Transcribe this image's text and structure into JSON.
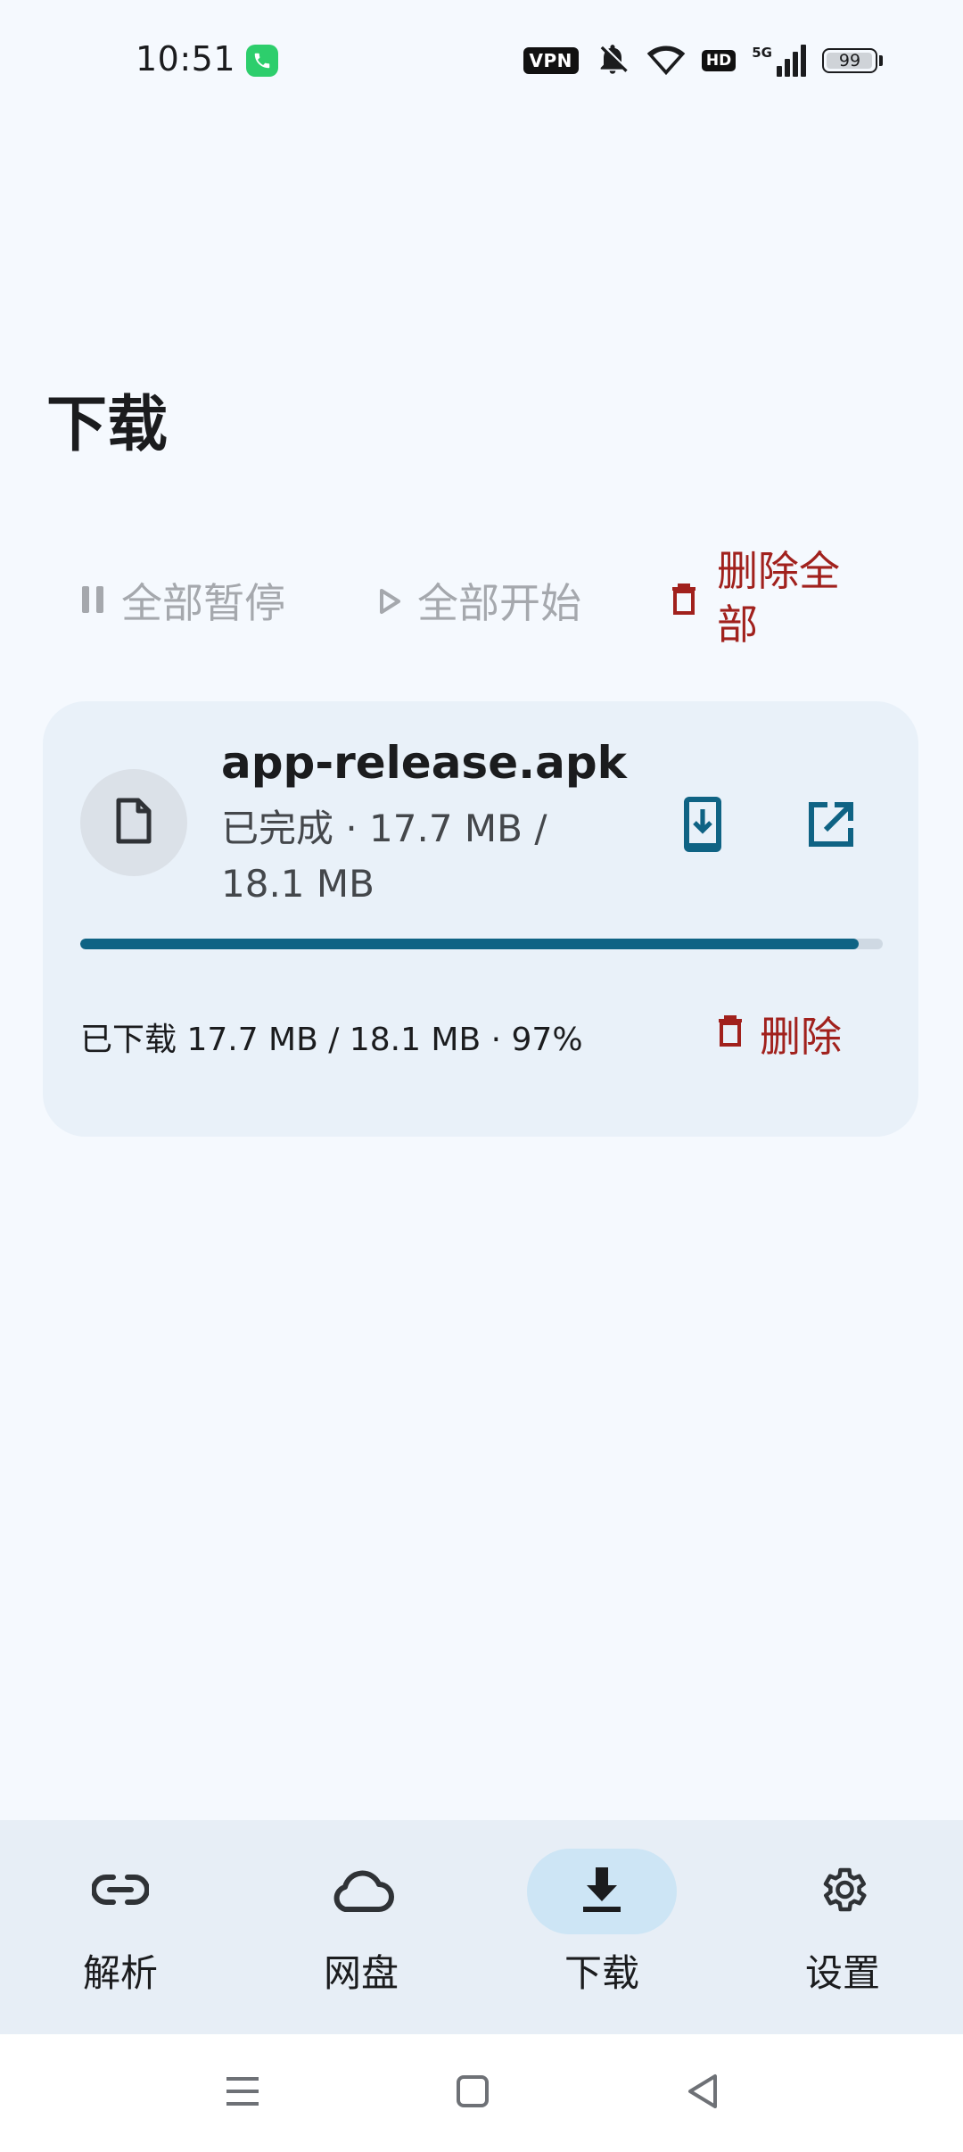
{
  "status_bar": {
    "time": "10:51",
    "vpn": "VPN",
    "hd": "HD",
    "network": "5G",
    "battery": "99",
    "battery_level": 0.99
  },
  "page": {
    "title": "下载"
  },
  "actions": {
    "pause_all": "全部暂停",
    "start_all": "全部开始",
    "delete_all": "删除全部"
  },
  "downloads": [
    {
      "file_name": "app-release.apk",
      "status": "已完成 · 17.7 MB / 18.1 MB",
      "progress": 0.97,
      "progress_text": "已下载 17.7 MB / 18.1 MB · 97%",
      "delete_label": "删除",
      "icon": "file-icon"
    }
  ],
  "nav": {
    "items": [
      {
        "label": "解析",
        "icon": "link-icon"
      },
      {
        "label": "网盘",
        "icon": "cloud-icon"
      },
      {
        "label": "下载",
        "icon": "download-icon",
        "active": true
      },
      {
        "label": "设置",
        "icon": "gear-icon"
      }
    ]
  },
  "colors": {
    "accent": "#0f6384",
    "danger": "#a1211d",
    "disabled": "#a5a8ad",
    "card": "#e9f1f9",
    "nav_bg": "#e7eef6",
    "nav_active": "#cde5f5"
  }
}
